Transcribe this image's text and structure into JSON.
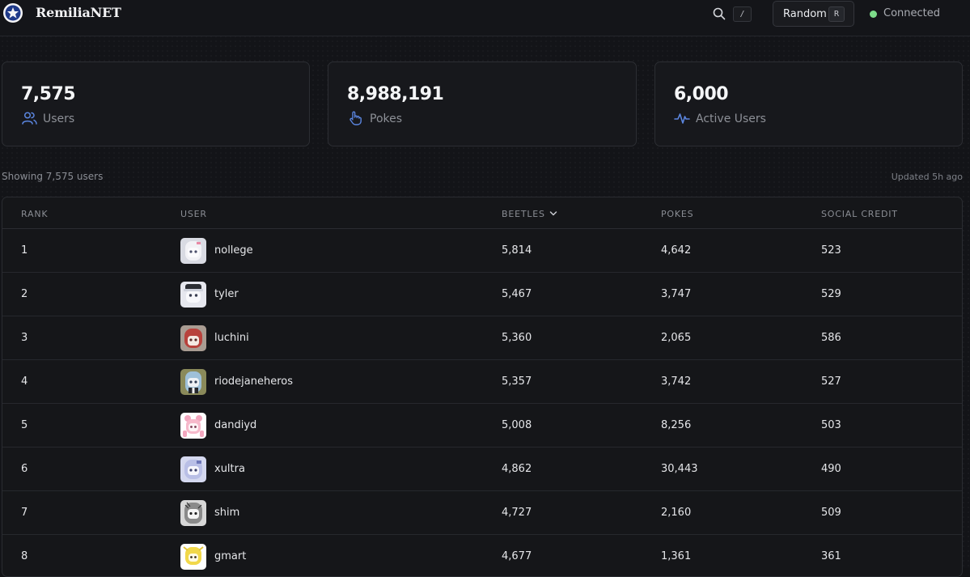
{
  "header": {
    "brand": "RemiliaNET",
    "search_shortcut": "/",
    "random_label": "Random",
    "random_shortcut": "R",
    "status": "Connected",
    "status_color": "#7ddc8a"
  },
  "stats": [
    {
      "value": "7,575",
      "label": "Users",
      "icon": "users-icon"
    },
    {
      "value": "8,988,191",
      "label": "Pokes",
      "icon": "poke-hand-icon"
    },
    {
      "value": "6,000",
      "label": "Active Users",
      "icon": "activity-icon"
    }
  ],
  "meta": {
    "showing": "Showing 7,575 users",
    "updated": "Updated 5h ago"
  },
  "table": {
    "columns": [
      "RANK",
      "USER",
      "BEETLES",
      "POKES",
      "SOCIAL CREDIT"
    ],
    "sorted_column": "BEETLES",
    "rows": [
      {
        "rank": "1",
        "user": "nollege",
        "beetles": "5,814",
        "pokes": "4,642",
        "social_credit": "523"
      },
      {
        "rank": "2",
        "user": "tyler",
        "beetles": "5,467",
        "pokes": "3,747",
        "social_credit": "529"
      },
      {
        "rank": "3",
        "user": "luchini",
        "beetles": "5,360",
        "pokes": "2,065",
        "social_credit": "586"
      },
      {
        "rank": "4",
        "user": "riodejaneheros",
        "beetles": "5,357",
        "pokes": "3,742",
        "social_credit": "527"
      },
      {
        "rank": "5",
        "user": "dandiyd",
        "beetles": "5,008",
        "pokes": "8,256",
        "social_credit": "503"
      },
      {
        "rank": "6",
        "user": "xultra",
        "beetles": "4,862",
        "pokes": "30,443",
        "social_credit": "490"
      },
      {
        "rank": "7",
        "user": "shim",
        "beetles": "4,727",
        "pokes": "2,160",
        "social_credit": "509"
      },
      {
        "rank": "8",
        "user": "gmart",
        "beetles": "4,677",
        "pokes": "1,361",
        "social_credit": "361"
      }
    ]
  },
  "colors": {
    "accent": "#4d7bd8",
    "background": "#131418"
  }
}
